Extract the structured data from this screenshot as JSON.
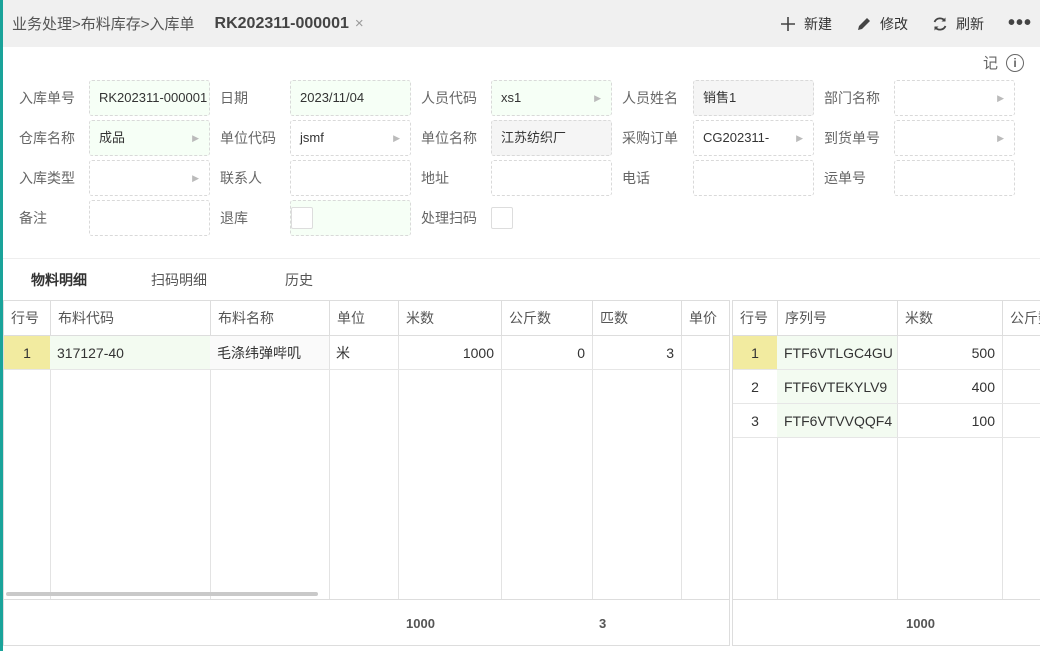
{
  "header": {
    "breadcrumb": "业务处理>布料库存>入库单",
    "doc_tab": "RK202311-000001",
    "close": "×"
  },
  "toolbar": {
    "new_label": "新建",
    "edit_label": "修改",
    "refresh_label": "刷新",
    "more_label": "•••"
  },
  "side_label": "记",
  "form": {
    "row1": {
      "receipt_no_label": "入库单号",
      "receipt_no": "RK202311-000001",
      "date_label": "日期",
      "date": "2023/11/04",
      "staff_code_label": "人员代码",
      "staff_code": "xs1",
      "staff_name_label": "人员姓名",
      "staff_name": "销售1",
      "dept_label": "部门名称",
      "dept": ""
    },
    "row2": {
      "warehouse_label": "仓库名称",
      "warehouse": "成品",
      "unit_code_label": "单位代码",
      "unit_code": "jsmf",
      "unit_name_label": "单位名称",
      "unit_name": "江苏纺织厂",
      "po_label": "采购订单",
      "po": "CG202311-",
      "arrival_label": "到货单号",
      "arrival": ""
    },
    "row3": {
      "type_label": "入库类型",
      "type": "",
      "contact_label": "联系人",
      "contact": "",
      "address_label": "地址",
      "address": "",
      "phone_label": "电话",
      "phone": "",
      "waybill_label": "运单号",
      "waybill": ""
    },
    "row4": {
      "remark_label": "备注",
      "remark": "",
      "return_label": "退库",
      "scan_label": "处理扫码"
    }
  },
  "tabs": [
    "物料明细",
    "扫码明细",
    "历史"
  ],
  "left_grid": {
    "columns": [
      "行号",
      "布料代码",
      "布料名称",
      "单位",
      "米数",
      "公斤数",
      "匹数",
      "单价"
    ],
    "rows": [
      {
        "idx": "1",
        "code": "317127-40",
        "name": "毛涤纬弹哔叽",
        "unit": "米",
        "meters": "1000",
        "kg": "0",
        "pieces": "3",
        "price": ""
      }
    ],
    "footer": {
      "meters": "1000",
      "pieces": "3"
    }
  },
  "right_grid": {
    "columns": [
      "行号",
      "序列号",
      "米数",
      "公斤数"
    ],
    "rows": [
      {
        "idx": "1",
        "serial": "FTF6VTLGC4GU",
        "meters": "500"
      },
      {
        "idx": "2",
        "serial": "FTF6VTEKYLV9",
        "meters": "400"
      },
      {
        "idx": "3",
        "serial": "FTF6VTVVQQF4",
        "meters": "100"
      }
    ],
    "footer": {
      "meters": "1000"
    }
  }
}
